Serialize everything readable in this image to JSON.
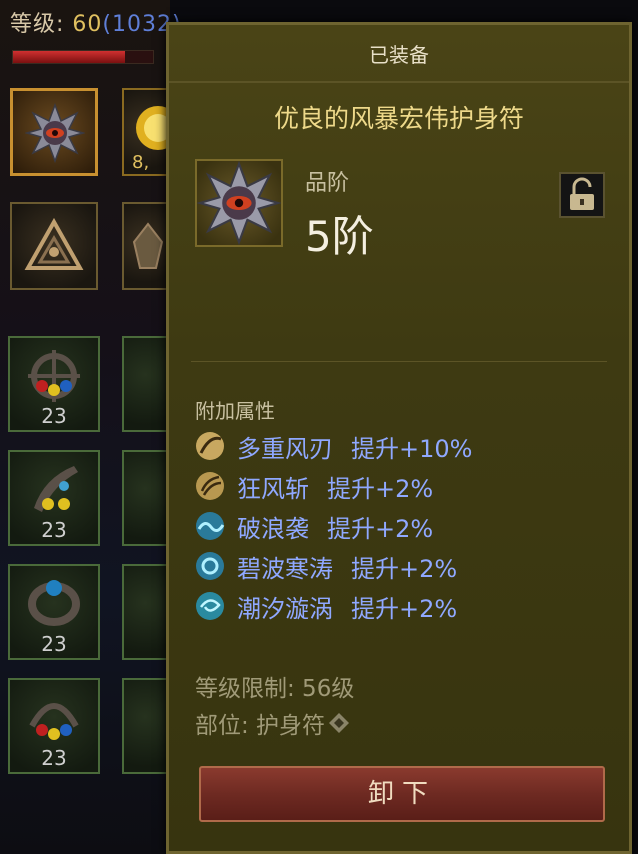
{
  "player": {
    "level_label": "等级:",
    "level": "60",
    "paragon": "(1032)",
    "hp_fraction": 0.8
  },
  "inventory": {
    "gold_count": "8,",
    "gems": [
      {
        "count": "23"
      },
      {
        "count": "23"
      },
      {
        "count": "23"
      },
      {
        "count": "23"
      }
    ]
  },
  "tooltip": {
    "status": "已装备",
    "item_name": "优良的风暴宏伟护身符",
    "tier_label": "品阶",
    "tier_value": "5阶",
    "attributes_heading": "附加属性",
    "attributes": [
      {
        "skill": "多重风刃",
        "boost": "提升+10%",
        "icon": "gold-blade-icon"
      },
      {
        "skill": "狂风斩",
        "boost": "提升+2%",
        "icon": "gold-wind-slash-icon"
      },
      {
        "skill": "破浪袭",
        "boost": "提升+2%",
        "icon": "cyan-wave-icon"
      },
      {
        "skill": "碧波寒涛",
        "boost": "提升+2%",
        "icon": "cyan-tide-icon"
      },
      {
        "skill": "潮汐漩涡",
        "boost": "提升+2%",
        "icon": "cyan-vortex-icon"
      }
    ],
    "level_requirement": "等级限制: 56级",
    "slot_label": "部位: 护身符",
    "unequip_label": "卸下"
  },
  "colors": {
    "item_name": "#eed98a",
    "attribute_text": "#8fa8ff",
    "unequip_button": "#7a3028"
  }
}
